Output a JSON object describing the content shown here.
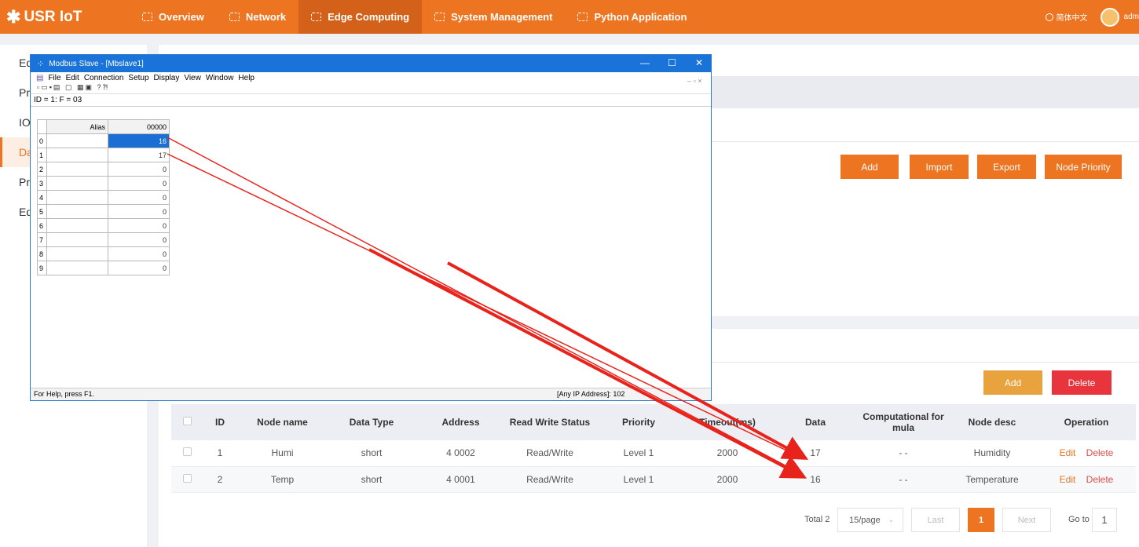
{
  "nav": {
    "logo": "USR IoT",
    "items": [
      {
        "label": "Overview",
        "active": false
      },
      {
        "label": "Network",
        "active": false
      },
      {
        "label": "Edge Computing",
        "active": true
      },
      {
        "label": "System Management",
        "active": false
      },
      {
        "label": "Python Application",
        "active": false
      }
    ],
    "lang": "简体中文",
    "user": "adm"
  },
  "sidebar": {
    "items": [
      {
        "label": "Edg",
        "active": false
      },
      {
        "label": "Pre",
        "active": false
      },
      {
        "label": "IO",
        "active": false
      },
      {
        "label": "Dat",
        "active": true
      },
      {
        "label": "Pro",
        "active": false
      },
      {
        "label": "Edg",
        "active": false
      }
    ]
  },
  "top_panel": {
    "buttons": {
      "add": "Add",
      "import": "Import",
      "export": "Export",
      "node_priority": "Node Priority"
    }
  },
  "node_panel": {
    "buttons": {
      "add": "Add",
      "delete": "Delete"
    },
    "columns": [
      "ID",
      "Node name",
      "Data Type",
      "Address",
      "Read Write Status",
      "Priority",
      "Timeout(ms)",
      "Data",
      "Computational for mula",
      "Node desc",
      "Operation"
    ],
    "rows": [
      {
        "id": "1",
        "name": "Humi",
        "type": "short",
        "address": "4 0002",
        "rw": "Read/Write",
        "priority": "Level 1",
        "timeout": "2000",
        "data": "17",
        "formula": "- -",
        "desc": "Humidity",
        "edit": "Edit",
        "delete": "Delete"
      },
      {
        "id": "2",
        "name": "Temp",
        "type": "short",
        "address": "4 0001",
        "rw": "Read/Write",
        "priority": "Level 1",
        "timeout": "2000",
        "data": "16",
        "formula": "- -",
        "desc": "Temperature",
        "edit": "Edit",
        "delete": "Delete"
      }
    ],
    "pager": {
      "total": "Total 2",
      "page_size": "15/page",
      "last": "Last",
      "current": "1",
      "next": "Next",
      "goto_label": "Go to",
      "goto_value": "1"
    }
  },
  "modbus": {
    "title": "Modbus Slave - [Mbslave1]",
    "menu": [
      "File",
      "Edit",
      "Connection",
      "Setup",
      "Display",
      "View",
      "Window",
      "Help"
    ],
    "id_line": "ID = 1: F = 03",
    "col_alias": "Alias",
    "col_addr": "00000",
    "rows": [
      {
        "n": "0",
        "v": "16",
        "selected": true
      },
      {
        "n": "1",
        "v": "17",
        "selected": false
      },
      {
        "n": "2",
        "v": "0",
        "selected": false
      },
      {
        "n": "3",
        "v": "0",
        "selected": false
      },
      {
        "n": "4",
        "v": "0",
        "selected": false
      },
      {
        "n": "5",
        "v": "0",
        "selected": false
      },
      {
        "n": "6",
        "v": "0",
        "selected": false
      },
      {
        "n": "7",
        "v": "0",
        "selected": false
      },
      {
        "n": "8",
        "v": "0",
        "selected": false
      },
      {
        "n": "9",
        "v": "0",
        "selected": false
      }
    ],
    "status_left": "For Help, press F1.",
    "status_right": "[Any IP Address]: 102"
  },
  "colors": {
    "accent": "#ed7522",
    "arrow": "#e8231c",
    "delete": "#e8343c",
    "add_node": "#e8a33e"
  }
}
